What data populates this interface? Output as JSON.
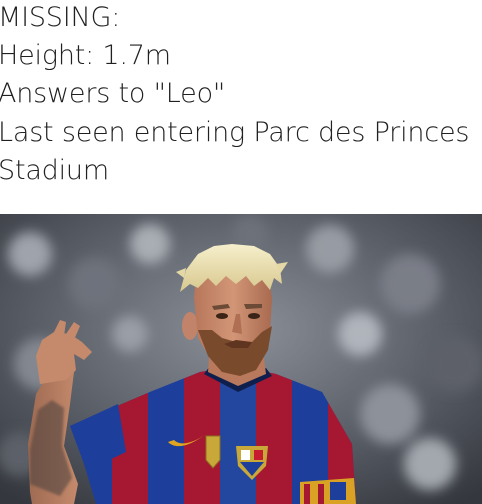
{
  "caption": {
    "lines": [
      "MISSING:",
      "Height: 1.7m",
      "Answers to \"Leo\"",
      "Last seen entering Parc des Princes",
      "Stadium"
    ]
  },
  "photo": {
    "subject": "footballer-photo",
    "colors": {
      "stripe_red": "#a61732",
      "stripe_blue": "#1d3f9b",
      "hair": "#ede3b2",
      "skin": "#c88a66",
      "beard": "#7a4a2c",
      "armband": "#d9a224"
    }
  }
}
